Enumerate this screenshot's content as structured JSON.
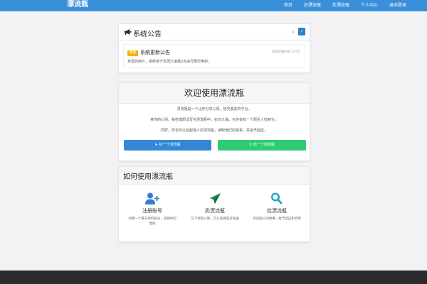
{
  "nav": {
    "brand": "漂流瓶",
    "links": [
      "首页",
      "扔漂流瓶",
      "捡漂流瓶",
      "个人中心",
      "退出登录"
    ]
  },
  "announcement": {
    "title": "系统公告",
    "prev_icon": "chevron-left-icon",
    "next_icon": "chevron-right-icon",
    "item": {
      "badge": "重要",
      "title": "系统更新公告",
      "date": "2025/06/30 17:47",
      "text": "亲爱的用户，系统将于本周六凌晨2点进行例行维护。"
    }
  },
  "welcome": {
    "title": "欢迎使用漂流瓶",
    "lines": [
      "漂流瓶是一个让你分享心情，结交朋友的平台。",
      "将你的心情、秘密或想法写在漂流瓶中，扔向大海，也许会有一个陌生人捡到它。",
      "同样，你也可以捡起他人的漂流瓶，读取他们的故事，并给予回应。"
    ],
    "throw_label": "扔一个漂流瓶",
    "pick_label": "捡一个漂流瓶"
  },
  "howto": {
    "title": "如何使用漂流瓶",
    "steps": [
      {
        "title": "注册账号",
        "desc": "创建一个属于你的账号，选择你的性别",
        "icon": "user-plus-icon",
        "color": "#2f7fd1"
      },
      {
        "title": "扔漂流瓶",
        "desc": "写下你的心情，可以选择是否发送",
        "icon": "paper-plane-icon",
        "color": "#1e8a4f"
      },
      {
        "title": "捡漂流瓶",
        "desc": "阅读陌人的故事，给予回应和点赞",
        "icon": "search-icon",
        "color": "#1aa3c7"
      }
    ]
  }
}
